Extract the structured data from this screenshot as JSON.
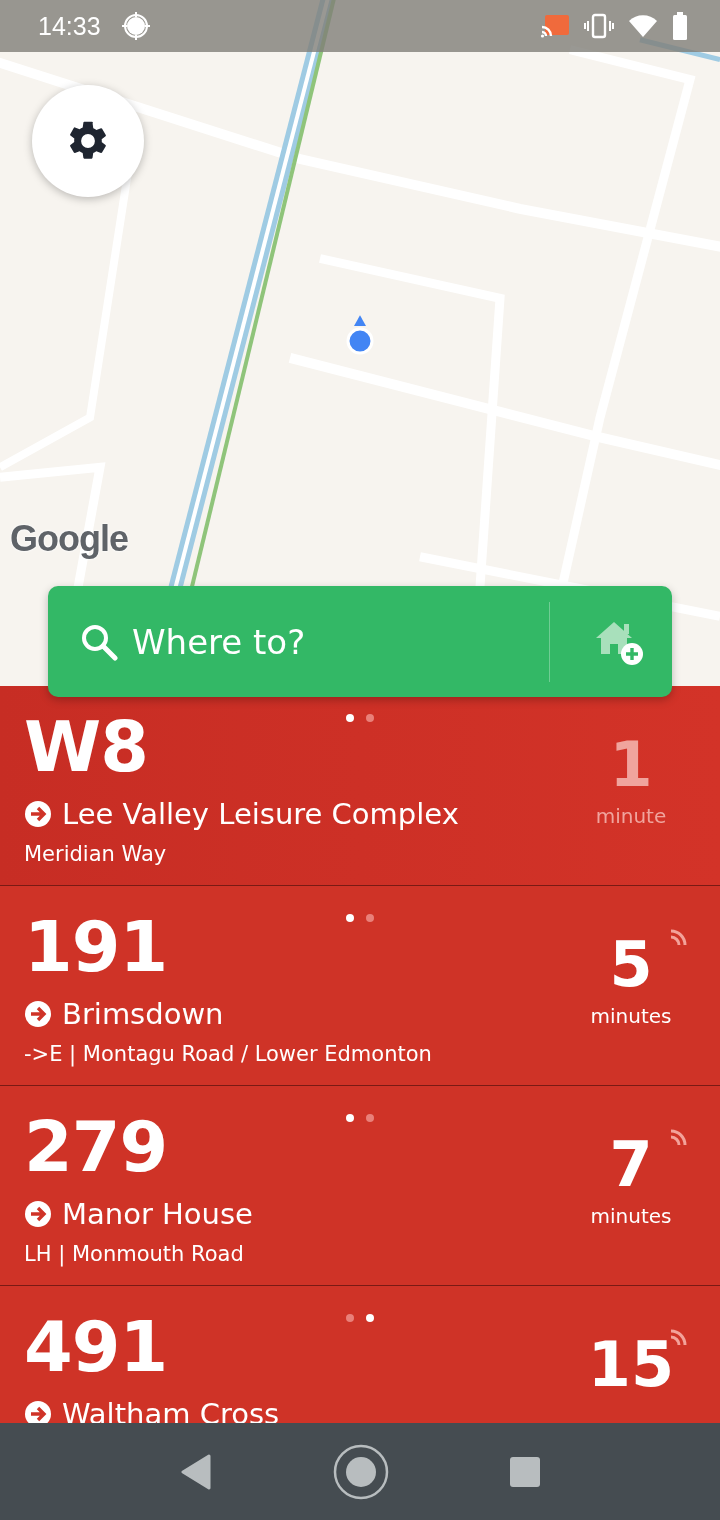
{
  "status_bar": {
    "time": "14:33"
  },
  "map": {
    "attribution": "Google"
  },
  "search": {
    "placeholder": "Where to?"
  },
  "departures": [
    {
      "route": "W8",
      "destination": "Lee Valley Leisure Complex",
      "stop": "Meridian Way",
      "time": "1",
      "unit": "minute",
      "live": false,
      "pages": [
        {
          "selected": true
        },
        {
          "selected": false
        }
      ]
    },
    {
      "route": "191",
      "destination": "Brimsdown",
      "stop": "->E | Montagu Road / Lower Edmonton",
      "time": "5",
      "unit": "minutes",
      "live": true,
      "pages": [
        {
          "selected": true
        },
        {
          "selected": false
        }
      ]
    },
    {
      "route": "279",
      "destination": "Manor House",
      "stop": "LH | Monmouth Road",
      "time": "7",
      "unit": "minutes",
      "live": true,
      "pages": [
        {
          "selected": true
        },
        {
          "selected": false
        }
      ]
    },
    {
      "route": "491",
      "destination": "Waltham Cross",
      "time": "15",
      "live": true,
      "pages": [
        {
          "selected": false
        },
        {
          "selected": true
        }
      ]
    }
  ]
}
